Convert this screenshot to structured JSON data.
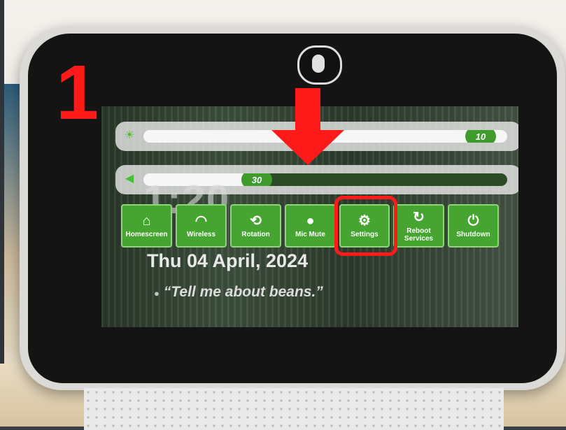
{
  "annotation": {
    "step_number": "1"
  },
  "screen": {
    "brightness_slider": {
      "value": "10",
      "level_fraction": 0.94
    },
    "volume_slider": {
      "value": "30",
      "level_fraction": 0.3
    },
    "time_partial": "1:20",
    "date": "Thu 04 April, 2024",
    "quote": "“Tell me about beans.”",
    "quick_buttons": [
      {
        "label": "Homescreen",
        "icon": "home-icon"
      },
      {
        "label": "Wireless",
        "icon": "wifi-icon"
      },
      {
        "label": "Rotation",
        "icon": "rotate-icon"
      },
      {
        "label": "Mic Mute",
        "icon": "microphone-icon"
      },
      {
        "label": "Settings",
        "icon": "gears-icon"
      },
      {
        "label": "Reboot Services",
        "icon": "refresh-icon"
      },
      {
        "label": "Shutdown",
        "icon": "power-icon"
      }
    ]
  },
  "colors": {
    "accent_green": "#45a530",
    "annotation_red": "#ff1a1a"
  }
}
